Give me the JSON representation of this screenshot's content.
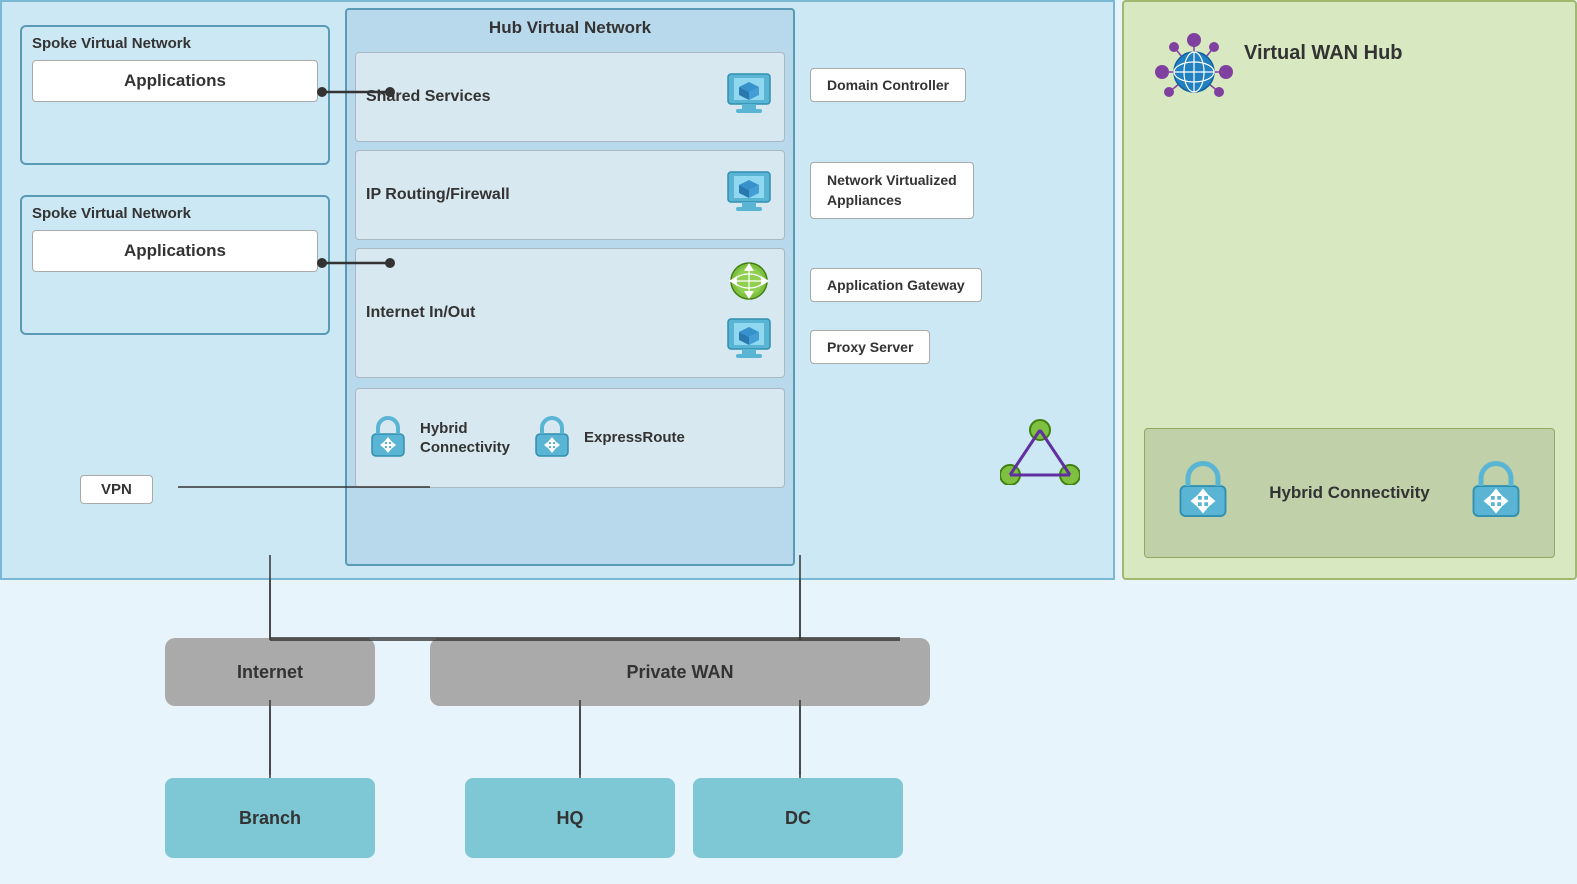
{
  "spokes": [
    {
      "title": "Spoke Virtual Network",
      "app_label": "Applications"
    },
    {
      "title": "Spoke Virtual Network",
      "app_label": "Applications"
    }
  ],
  "hub": {
    "title": "Hub Virtual Network",
    "rows": [
      {
        "label": "Shared Services",
        "icon": "monitor-blue"
      },
      {
        "label": "IP Routing/Firewall",
        "icon": "monitor-blue"
      },
      {
        "label": "Internet In/Out",
        "icon": "gateway-green"
      }
    ],
    "service_boxes": [
      {
        "label": "Domain Controller"
      },
      {
        "label": "Network  Virtualized\nAppliances"
      },
      {
        "label": "Application Gateway"
      },
      {
        "label": "Proxy Server"
      }
    ],
    "hybrid": {
      "label": "Hybrid\nConnectivity",
      "express_label": "ExpressRoute"
    }
  },
  "vpn_label": "VPN",
  "wan_hub": {
    "title": "Virtual WAN Hub",
    "hybrid_label": "Hybrid\nConnectivity"
  },
  "bottom": {
    "internet": "Internet",
    "private_wan": "Private WAN",
    "branch": "Branch",
    "hq": "HQ",
    "dc": "DC"
  }
}
